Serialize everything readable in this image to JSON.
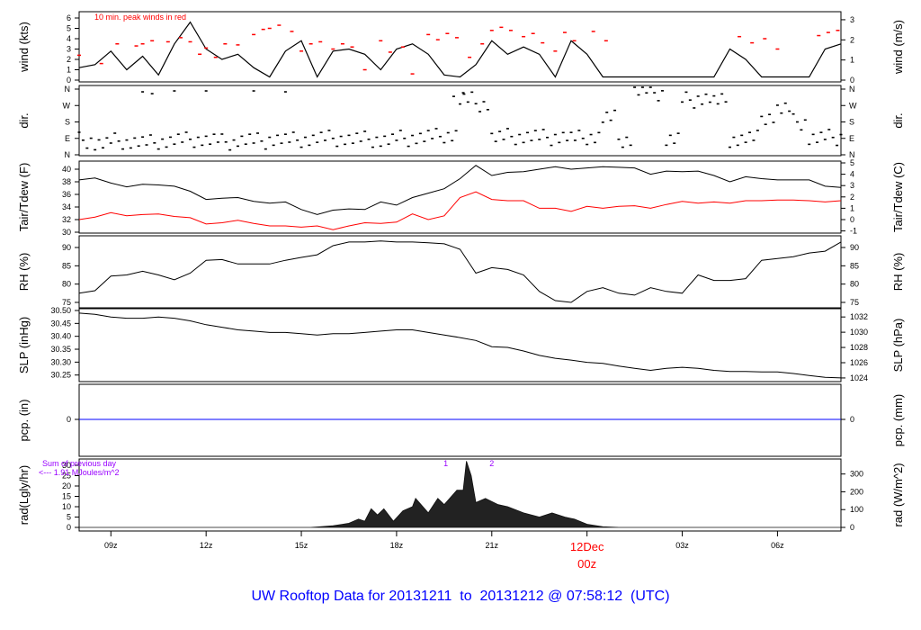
{
  "chart_data": {
    "type": "line",
    "title": "UW Rooftop Data for 20131211  to  20131212 @ 07:58:12  (UTC)",
    "time_unit": "hours UTC since 00z 11Dec",
    "xlim": [
      8.0,
      32.0
    ],
    "x_ticks": [
      {
        "t": 9,
        "label": "09z"
      },
      {
        "t": 12,
        "label": "12z"
      },
      {
        "t": 15,
        "label": "15z"
      },
      {
        "t": 18,
        "label": "18z"
      },
      {
        "t": 21,
        "label": "21z"
      },
      {
        "t": 24,
        "label": "00z",
        "date_label": "12Dec",
        "highlight": true
      },
      {
        "t": 27,
        "label": "03z"
      },
      {
        "t": 30,
        "label": "06z"
      }
    ],
    "highlight_color": "#ff0000",
    "title_color": "#0000ff",
    "sample_start": 8.0,
    "sample_step": 0.5,
    "panels": {
      "wind": {
        "ylabel": "wind (kts)",
        "ylabel_right": "wind (m/s)",
        "left_ticks": [
          0,
          1,
          2,
          3,
          4,
          5,
          6
        ],
        "right_ticks": [
          0,
          1,
          2,
          3
        ],
        "annotation": "10 min. peak winds in red",
        "values": [
          1.2,
          1.5,
          2.8,
          1.0,
          2.3,
          0.5,
          3.5,
          5.6,
          3.0,
          2.0,
          2.5,
          1.2,
          0.3,
          2.8,
          3.8,
          0.3,
          2.8,
          3.0,
          2.5,
          1.0,
          3.0,
          3.5,
          2.5,
          0.5,
          0.3,
          1.5,
          3.8,
          2.5,
          3.2,
          2.5,
          0.3,
          3.8,
          2.5,
          0.3,
          0.3,
          0.3,
          0.3,
          0.3,
          0.3,
          0.3,
          0.3,
          3.0,
          2.0,
          0.3,
          0.3,
          0.3,
          0.3,
          3.0,
          3.5
        ],
        "peaks": [
          [
            8.0,
            2.4
          ],
          [
            8.7,
            1.6
          ],
          [
            9.2,
            3.5
          ],
          [
            9.8,
            3.3
          ],
          [
            10.0,
            3.5
          ],
          [
            10.3,
            3.8
          ],
          [
            10.8,
            3.7
          ],
          [
            11.2,
            4.1
          ],
          [
            11.5,
            3.7
          ],
          [
            11.8,
            2.5
          ],
          [
            12.0,
            3.1
          ],
          [
            12.3,
            2.2
          ],
          [
            12.6,
            3.5
          ],
          [
            13.0,
            3.4
          ],
          [
            13.5,
            4.4
          ],
          [
            13.8,
            4.9
          ],
          [
            14.0,
            5.0
          ],
          [
            14.3,
            5.3
          ],
          [
            14.7,
            4.7
          ],
          [
            15.0,
            2.8
          ],
          [
            15.3,
            3.5
          ],
          [
            15.6,
            3.7
          ],
          [
            16.0,
            3.0
          ],
          [
            16.3,
            3.5
          ],
          [
            16.6,
            3.2
          ],
          [
            17.0,
            1.0
          ],
          [
            17.5,
            3.8
          ],
          [
            17.8,
            2.7
          ],
          [
            18.2,
            3.2
          ],
          [
            18.5,
            0.6
          ],
          [
            19.0,
            4.4
          ],
          [
            19.3,
            3.9
          ],
          [
            19.6,
            4.5
          ],
          [
            19.9,
            4.1
          ],
          [
            20.3,
            2.2
          ],
          [
            20.7,
            3.5
          ],
          [
            21.0,
            4.8
          ],
          [
            21.3,
            5.1
          ],
          [
            21.6,
            4.8
          ],
          [
            22.0,
            4.2
          ],
          [
            22.3,
            4.5
          ],
          [
            22.6,
            3.6
          ],
          [
            23.0,
            2.8
          ],
          [
            23.3,
            4.6
          ],
          [
            23.6,
            3.8
          ],
          [
            24.2,
            4.7
          ],
          [
            24.6,
            3.8
          ],
          [
            28.8,
            4.2
          ],
          [
            29.2,
            3.6
          ],
          [
            29.6,
            4.0
          ],
          [
            30.0,
            3.0
          ],
          [
            31.3,
            4.3
          ],
          [
            31.6,
            4.6
          ],
          [
            31.9,
            4.8
          ]
        ],
        "peak_color": "#ff0000"
      },
      "dir": {
        "ylabel": "dir.",
        "ylabel_right": "dir.",
        "tick_labels": [
          {
            "deg": 0,
            "label": "N"
          },
          {
            "deg": 90,
            "label": "E"
          },
          {
            "deg": 180,
            "label": "S"
          },
          {
            "deg": 270,
            "label": "W"
          },
          {
            "deg": 360,
            "label": "N"
          }
        ],
        "values": [
          80,
          60,
          75,
          70,
          65,
          75,
          80,
          85,
          80,
          70,
          80,
          75,
          85,
          80,
          85,
          90,
          90,
          85,
          85,
          80,
          90,
          95,
          100,
          110,
          300,
          280,
          95,
          100,
          100,
          95,
          100,
          90,
          100,
          200,
          85,
          350,
          340,
          85,
          300,
          310,
          290,
          85,
          90,
          210,
          250,
          180,
          90,
          95,
          100
        ],
        "outliers": [
          [
            10.0,
            345
          ],
          [
            10.3,
            335
          ],
          [
            11.0,
            350
          ],
          [
            12.0,
            350
          ],
          [
            13.5,
            350
          ],
          [
            14.5,
            345
          ],
          [
            19.8,
            320
          ],
          [
            20.1,
            340
          ]
        ]
      },
      "tair": {
        "ylabel": "Tair/Tdew (F)",
        "ylabel_right": "Tair/Tdew (C)",
        "left_ticks": [
          30,
          32,
          34,
          36,
          38,
          40
        ],
        "right_ticks": [
          -1,
          0,
          1,
          2,
          3,
          4,
          5
        ],
        "series": [
          {
            "name": "Tair",
            "color": "#000000",
            "values": [
              38.3,
              38.6,
              37.8,
              37.2,
              37.6,
              37.5,
              37.3,
              36.5,
              35.2,
              35.4,
              35.5,
              34.9,
              34.6,
              34.8,
              33.6,
              32.8,
              33.5,
              33.7,
              33.6,
              34.8,
              34.3,
              35.5,
              36.2,
              36.9,
              38.5,
              40.6,
              39.0,
              39.5,
              39.6,
              40.0,
              40.4,
              40.0,
              40.2,
              40.4,
              40.3,
              40.2,
              39.2,
              39.7,
              39.6,
              39.7,
              39.0,
              38.0,
              38.8,
              38.5,
              38.3,
              38.3,
              38.3,
              37.3,
              37.1
            ]
          },
          {
            "name": "Tdew",
            "color": "#ff0000",
            "values": [
              32.0,
              32.4,
              33.1,
              32.6,
              32.8,
              32.9,
              32.5,
              32.3,
              31.3,
              31.5,
              31.9,
              31.4,
              31.0,
              31.0,
              30.8,
              31.0,
              30.4,
              31.0,
              31.5,
              31.4,
              31.6,
              32.9,
              32.0,
              32.6,
              35.5,
              36.4,
              35.2,
              35.0,
              35.0,
              33.8,
              33.8,
              33.3,
              34.1,
              33.8,
              34.1,
              34.2,
              33.8,
              34.4,
              34.9,
              34.6,
              34.8,
              34.6,
              35.0,
              35.0,
              35.1,
              35.1,
              35.0,
              34.8,
              35.0
            ]
          }
        ]
      },
      "rh": {
        "ylabel": "RH (%)",
        "ylabel_right": "RH (%)",
        "left_ticks": [
          75,
          80,
          85,
          90
        ],
        "right_ticks": [
          75,
          80,
          85,
          90
        ],
        "values": [
          77.5,
          78.2,
          82.2,
          82.5,
          83.5,
          82.5,
          81.2,
          83.0,
          86.5,
          86.7,
          85.5,
          85.5,
          85.5,
          86.5,
          87.3,
          88.0,
          90.5,
          91.5,
          91.5,
          91.8,
          91.5,
          91.5,
          91.3,
          91.0,
          89.5,
          83.0,
          84.5,
          84.0,
          82.5,
          78.0,
          75.5,
          75.0,
          78.0,
          79.0,
          77.5,
          77.0,
          79.0,
          78.0,
          77.5,
          82.5,
          81.0,
          81.0,
          81.5,
          86.5,
          87.0,
          87.5,
          88.5,
          89.0,
          91.5
        ]
      },
      "slp": {
        "ylabel": "SLP (inHg)",
        "ylabel_right": "SLP (hPa)",
        "left_ticks": [
          "30.25",
          "30.30",
          "30.35",
          "30.40",
          "30.45",
          "30.50"
        ],
        "right_ticks": [
          1024,
          1026,
          1028,
          1030,
          1032
        ],
        "values": [
          30.49,
          30.485,
          30.475,
          30.47,
          30.47,
          30.475,
          30.47,
          30.46,
          30.445,
          30.435,
          30.425,
          30.42,
          30.415,
          30.415,
          30.41,
          30.405,
          30.41,
          30.41,
          30.415,
          30.42,
          30.425,
          30.425,
          30.415,
          30.405,
          30.395,
          30.384,
          30.36,
          30.357,
          30.343,
          30.326,
          30.315,
          30.308,
          30.299,
          30.295,
          30.285,
          30.276,
          30.268,
          30.276,
          30.28,
          30.276,
          30.268,
          30.264,
          30.264,
          30.262,
          30.262,
          30.256,
          30.248,
          30.241,
          30.239
        ]
      },
      "pcp": {
        "ylabel": "pcp. (in)",
        "ylabel_right": "pcp. (mm)",
        "left_ticks": [
          0
        ],
        "right_ticks": [
          0
        ],
        "color": "#0000ff",
        "values": [
          0,
          0
        ]
      },
      "rad": {
        "ylabel": "rad(Lgly/hr)",
        "ylabel_right": "rad (W/m^2)",
        "left_ticks": [
          0,
          5,
          10,
          15,
          20,
          25,
          30
        ],
        "right_ticks": [
          0,
          100,
          200,
          300
        ],
        "annotation_line1": "Sum of previous day",
        "annotation_line2": "<--- 1.91 MJoules/m^2",
        "annotation_color": "#9900ff",
        "markers": [
          {
            "t": 19.55,
            "label": "1"
          },
          {
            "t": 21.0,
            "label": "2"
          }
        ],
        "points": [
          [
            8.0,
            0
          ],
          [
            15.3,
            0
          ],
          [
            15.5,
            0.2
          ],
          [
            16.0,
            0.8
          ],
          [
            16.5,
            2
          ],
          [
            16.8,
            4
          ],
          [
            17.0,
            3
          ],
          [
            17.2,
            9
          ],
          [
            17.4,
            6
          ],
          [
            17.6,
            9
          ],
          [
            17.9,
            3
          ],
          [
            18.2,
            8
          ],
          [
            18.5,
            10
          ],
          [
            18.6,
            14
          ],
          [
            19.0,
            7
          ],
          [
            19.3,
            14
          ],
          [
            19.5,
            11
          ],
          [
            19.9,
            18
          ],
          [
            20.1,
            18
          ],
          [
            20.2,
            32
          ],
          [
            20.35,
            25
          ],
          [
            20.5,
            12
          ],
          [
            20.8,
            14
          ],
          [
            21.2,
            11
          ],
          [
            21.5,
            10
          ],
          [
            22.0,
            7
          ],
          [
            22.5,
            5
          ],
          [
            22.9,
            7
          ],
          [
            23.3,
            5
          ],
          [
            23.6,
            4
          ],
          [
            24.0,
            1.5
          ],
          [
            24.5,
            0.3
          ],
          [
            25.0,
            0
          ],
          [
            32.0,
            0
          ]
        ]
      }
    }
  }
}
